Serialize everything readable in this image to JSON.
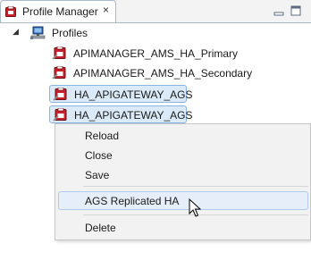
{
  "tab": {
    "title": "Profile Manager",
    "close_glyph": "×",
    "icon": "profile-manager-icon"
  },
  "tree": {
    "root_label": "Profiles",
    "root_icon": "computer-network-icon",
    "root_expanded": true,
    "items": [
      {
        "label": "APIMANAGER_AMS_HA_Primary",
        "selected": false
      },
      {
        "label": "APIMANAGER_AMS_HA_Secondary",
        "selected": false
      },
      {
        "label": "HA_APIGATEWAY_AGS",
        "selected": true
      },
      {
        "label": "HA_APIGATEWAY_AGS",
        "selected": true
      }
    ]
  },
  "context_menu": {
    "reload": "Reload",
    "close": "Close",
    "save": "Save",
    "replicated": "AGS Replicated HA",
    "delete": "Delete"
  },
  "colors": {
    "selection_bg": "#dbeaf8",
    "selection_border": "#8cb4e0",
    "menu_bg": "#f2f2f2",
    "profile_icon_red": "#c8202c"
  }
}
